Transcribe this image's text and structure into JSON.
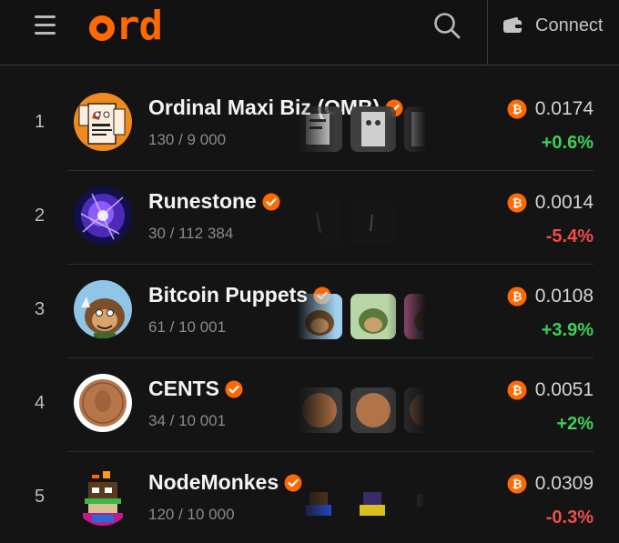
{
  "header": {
    "menu_icon": "hamburger-menu-icon",
    "logo_text": "rd",
    "search_icon": "search-icon",
    "connect_label": "Connect",
    "wallet_icon": "wallet-icon",
    "brand_color": "#ff6a00"
  },
  "colors": {
    "positive": "#3cd05a",
    "negative": "#f04d4d",
    "accent": "#ff6a00"
  },
  "collections": [
    {
      "rank": "1",
      "name": "Ordinal Maxi Biz (OMB)",
      "supply": "130 / 9 000",
      "price": "0.0174",
      "change": "+0.6%",
      "trend": "up"
    },
    {
      "rank": "2",
      "name": "Runestone",
      "supply": "30 / 112 384",
      "price": "0.0014",
      "change": "-5.4%",
      "trend": "down"
    },
    {
      "rank": "3",
      "name": "Bitcoin Puppets",
      "supply": "61 / 10 001",
      "price": "0.0108",
      "change": "+3.9%",
      "trend": "up"
    },
    {
      "rank": "4",
      "name": "CENTS",
      "supply": "34 / 10 001",
      "price": "0.0051",
      "change": "+2%",
      "trend": "up"
    },
    {
      "rank": "5",
      "name": "NodeMonkes",
      "supply": "120 / 10 000",
      "price": "0.0309",
      "change": "-0.3%",
      "trend": "down"
    }
  ]
}
